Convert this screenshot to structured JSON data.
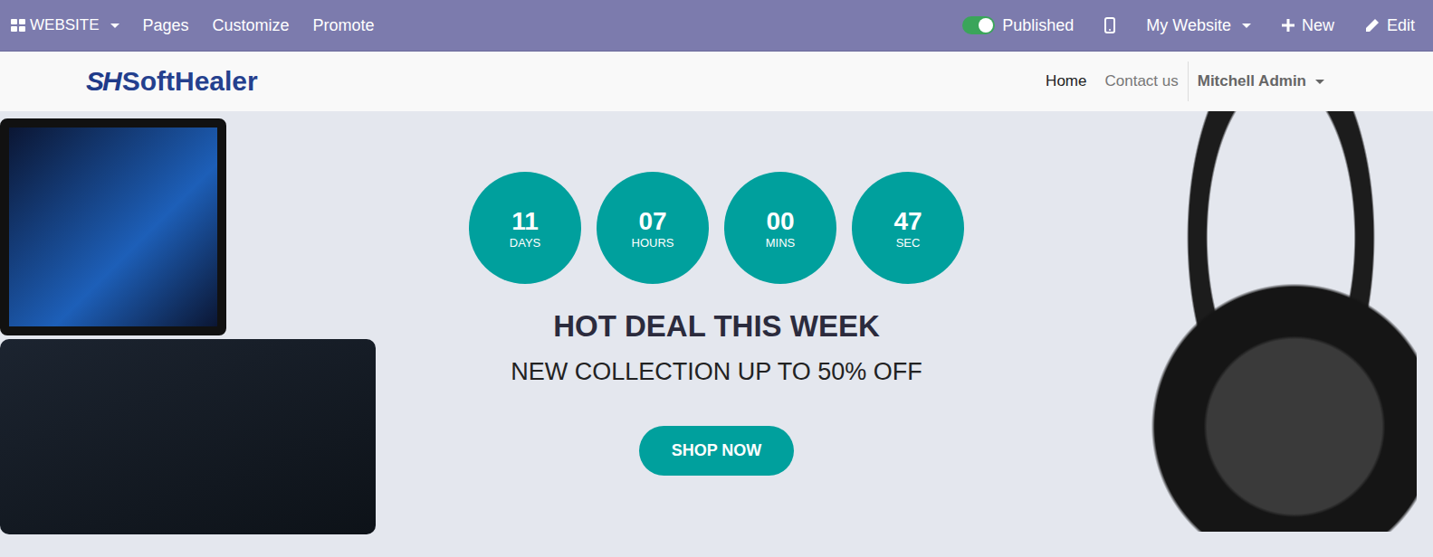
{
  "admin_bar": {
    "app": "WEBSITE",
    "menus": [
      "Pages",
      "Customize",
      "Promote"
    ],
    "published": {
      "label": "Published",
      "on": true
    },
    "website": "My Website",
    "new": "New",
    "edit": "Edit"
  },
  "header": {
    "logo": {
      "mark": "SH",
      "name": "SoftHealer"
    },
    "nav": [
      {
        "label": "Home",
        "selected": true
      },
      {
        "label": "Contact us",
        "selected": false
      }
    ],
    "user": "Mitchell Admin"
  },
  "hero": {
    "countdown": [
      {
        "value": "11",
        "unit": "DAYS"
      },
      {
        "value": "07",
        "unit": "HOURS"
      },
      {
        "value": "00",
        "unit": "MINS"
      },
      {
        "value": "47",
        "unit": "SEC"
      }
    ],
    "title": "HOT DEAL THIS WEEK",
    "subtitle": "NEW COLLECTION UP TO 50% OFF",
    "button": "SHOP NOW"
  }
}
